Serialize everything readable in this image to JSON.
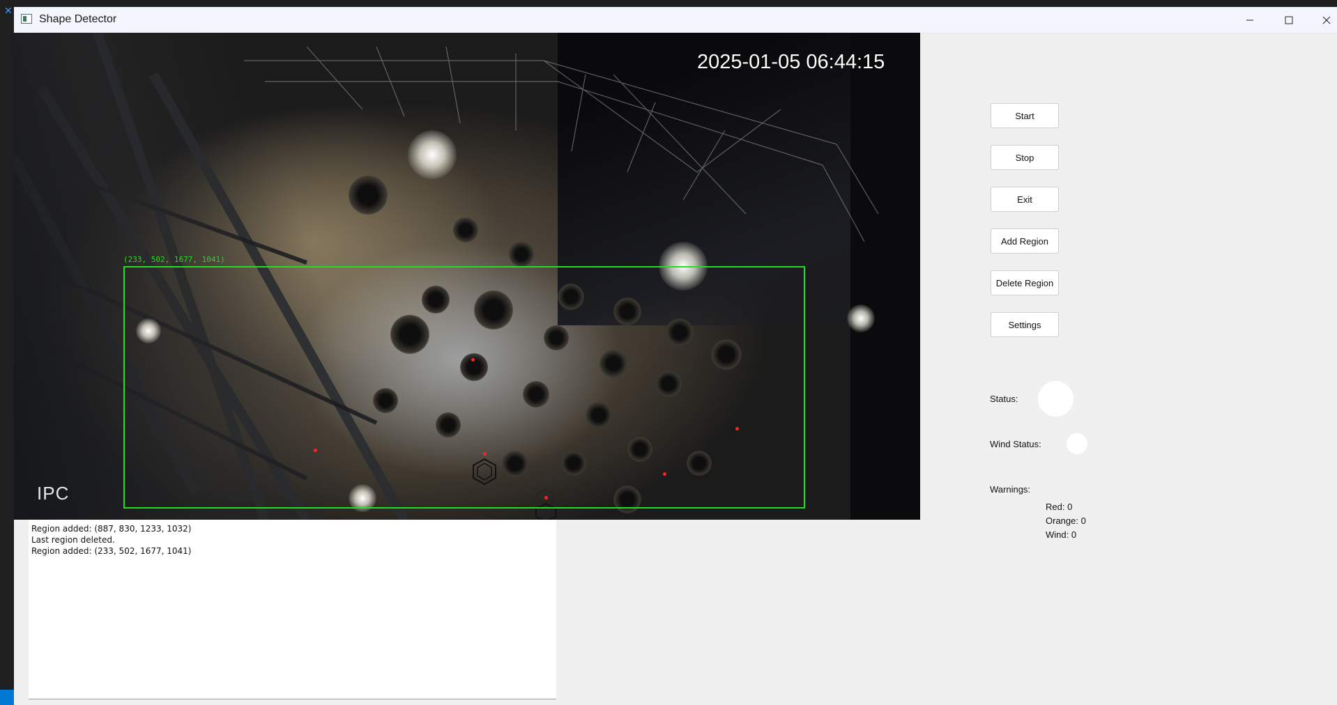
{
  "window": {
    "title": "Shape Detector"
  },
  "video": {
    "timestamp": "2025-01-05 06:44:15",
    "watermark": "IPC",
    "region_overlay_label": "(233, 502, 1677, 1041)"
  },
  "log": {
    "lines": [
      "Region added: (887, 830, 1233, 1032)",
      "Last region deleted.",
      "Region added: (233, 502, 1677, 1041)"
    ]
  },
  "controls": {
    "start": "Start",
    "stop": "Stop",
    "exit": "Exit",
    "add_region": "Add Region",
    "delete_region": "Delete Region",
    "settings": "Settings"
  },
  "status": {
    "status_label": "Status:",
    "wind_status_label": "Wind Status:",
    "status_color": "#ffffff",
    "wind_color": "#ffffff"
  },
  "warnings": {
    "title": "Warnings:",
    "red": "Red: 0",
    "orange": "Orange: 0",
    "wind": "Wind: 0"
  },
  "colors": {
    "region_box": "#22dd22",
    "detection_marker": "#ff2222"
  }
}
